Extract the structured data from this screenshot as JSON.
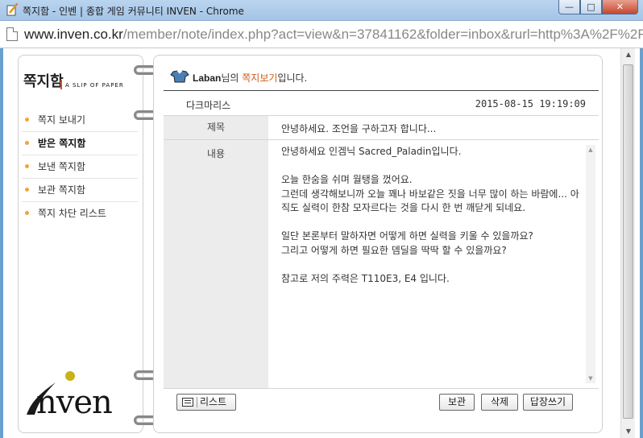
{
  "window": {
    "title": "쪽지함 - 인벤 | 종합 게임 커뮤니티 INVEN - Chrome",
    "minimize_label": "—",
    "maximize_label": "□",
    "close_label": "✕"
  },
  "address": {
    "host": "www.inven.co.kr",
    "path": "/member/note/index.php?act=view&n=37841162&folder=inbox&rurl=http%3A%2F%2F"
  },
  "sidebar": {
    "title": "쪽지함",
    "subtitle": "A SLIP OF PAPER",
    "items": [
      {
        "label": "쪽지 보내기"
      },
      {
        "label": "받은 쪽지함"
      },
      {
        "label": "보낸 쪽지함"
      },
      {
        "label": "보관 쪽지함"
      },
      {
        "label": "쪽지 차단 리스트"
      }
    ],
    "active_index": 1,
    "brand": "nven"
  },
  "note": {
    "header_sender": "Laban",
    "header_mid": "님의 ",
    "header_accent": "쪽지보기",
    "header_end": "입니다.",
    "from": "다크마리스",
    "date": "2015-08-15 19:19:09",
    "subject_label": "제목",
    "subject": "안녕하세요. 조언을 구하고자 합니다...",
    "body_label": "내용",
    "body": [
      "안녕하세요 인겜닉 Sacred_Paladin입니다.",
      "오늘 한숨을 쉬며 월탱을 껐어요.",
      "그런데 생각해보니까 오늘 꽤나 바보같은 짓을 너무 많이 하는 바람에... 아직도 실력이 한참 모자르다는 것을 다시 한 번 깨닫게 되네요.",
      "일단 본론부터 말하자면 어떻게 하면 실력을 키울 수 있을까요?",
      "그리고 어떻게 하면 필요한 뎀딜을 딱딱 할 수 있을까요?",
      "참고로 저의 주력은 T110E3, E4 입니다."
    ]
  },
  "buttons": {
    "list": "리스트",
    "keep": "보관",
    "delete": "삭제",
    "reply": "답장쓰기"
  }
}
